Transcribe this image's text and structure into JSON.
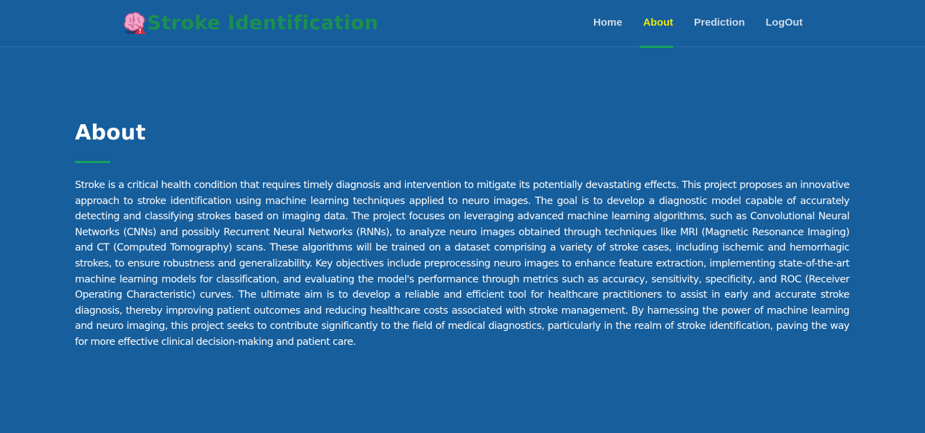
{
  "header": {
    "logo_icon": "brain-alert-icon",
    "brand": "Stroke Identification",
    "brand_color": "#1b8f52"
  },
  "nav": {
    "items": [
      {
        "label": "Home"
      },
      {
        "label": "About"
      },
      {
        "label": "Prediction"
      },
      {
        "label": "LogOut"
      }
    ],
    "active": "About",
    "active_color": "#ebe90e",
    "accent_color": "#16a35e"
  },
  "about": {
    "title": "About",
    "body": "Stroke is a critical health condition that requires timely diagnosis and intervention to mitigate its potentially devastating effects. This project proposes an innovative approach to stroke identification using machine learning techniques applied to neuro images. The goal is to develop a diagnostic model capable of accurately detecting and classifying strokes based on imaging data. The project focuses on leveraging advanced machine learning algorithms, such as Convolutional Neural Networks (CNNs) and possibly Recurrent Neural Networks (RNNs), to analyze neuro images obtained through techniques like MRI (Magnetic Resonance Imaging) and CT (Computed Tomography) scans. These algorithms will be trained on a dataset comprising a variety of stroke cases, including ischemic and hemorrhagic strokes, to ensure robustness and generalizability. Key objectives include preprocessing neuro images to enhance feature extraction, implementing state-of-the-art machine learning models for classification, and evaluating the model's performance through metrics such as accuracy, sensitivity, specificity, and ROC (Receiver Operating Characteristic) curves. The ultimate aim is to develop a reliable and efficient tool for healthcare practitioners to assist in early and accurate stroke diagnosis, thereby improving patient outcomes and reducing healthcare costs associated with stroke management. By harnessing the power of machine learning and neuro imaging, this project seeks to contribute significantly to the field of medical diagnostics, particularly in the realm of stroke identification, paving the way for more effective clinical decision-making and patient care."
  },
  "colors": {
    "background": "#175e9c",
    "text": "#ffffff"
  }
}
